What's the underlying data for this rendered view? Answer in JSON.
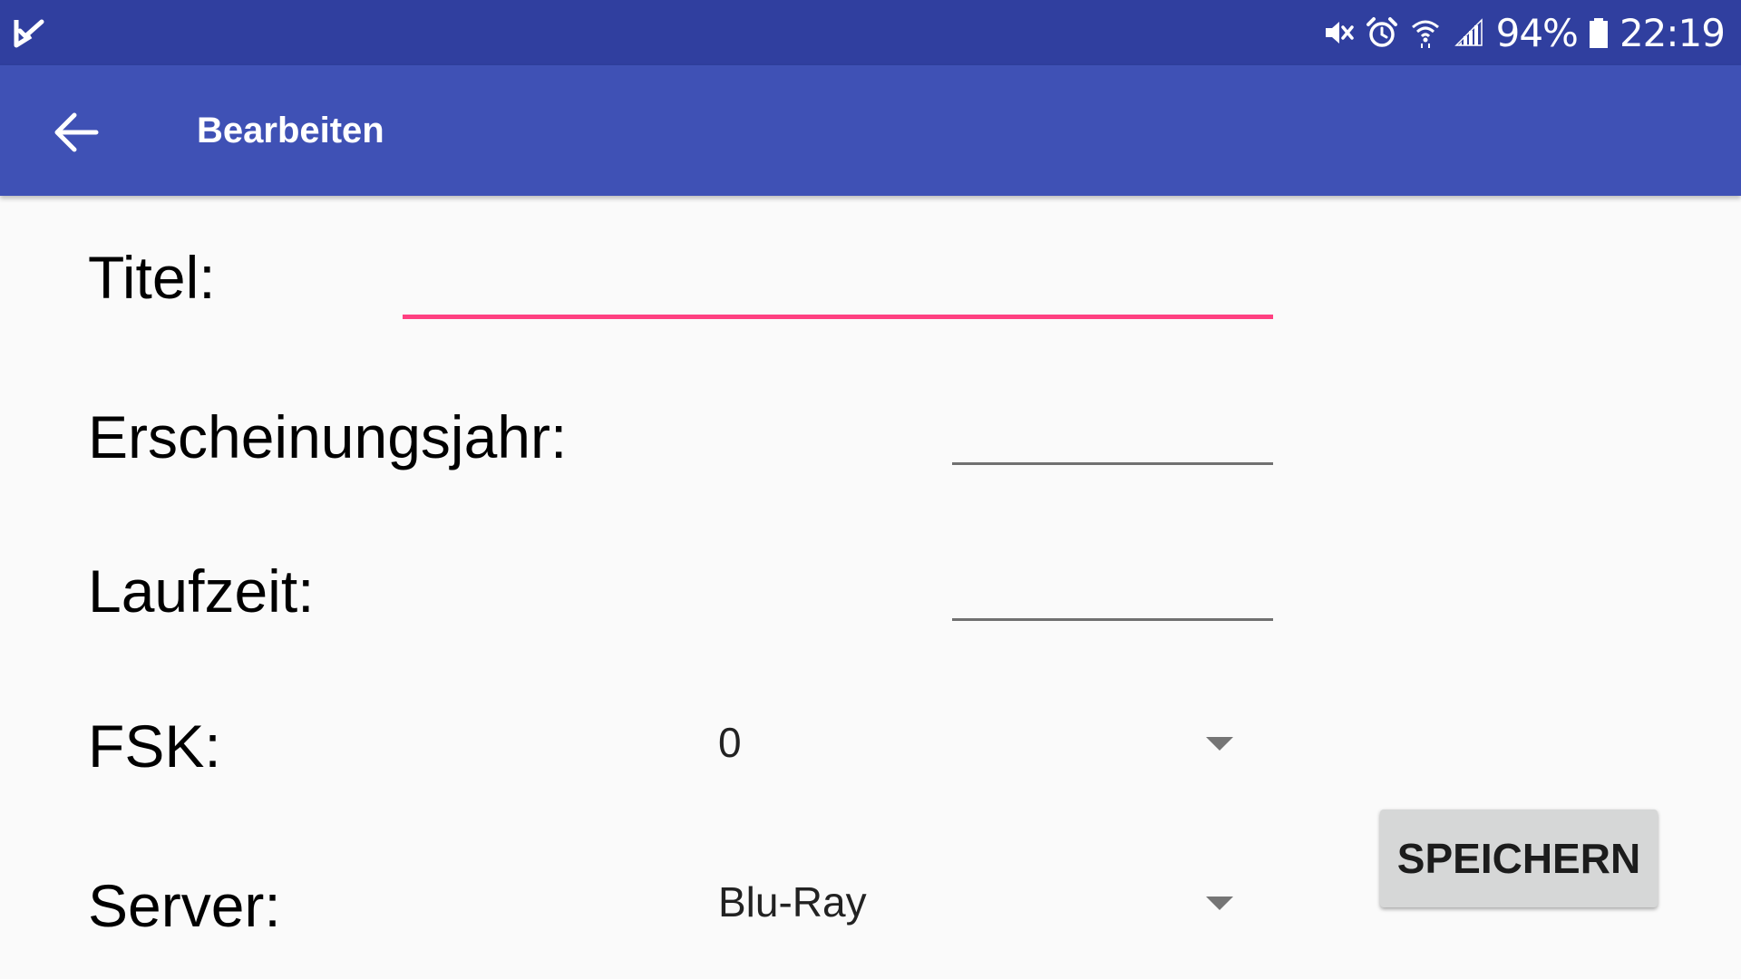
{
  "status_bar": {
    "battery": "94%",
    "time": "22:19",
    "icons": [
      "checkmark-notification-icon",
      "mute-icon",
      "alarm-icon",
      "wifi-icon",
      "signal-icon",
      "battery-icon"
    ]
  },
  "app_bar": {
    "title": "Bearbeiten",
    "back_icon": "arrow-back-icon"
  },
  "form": {
    "title": {
      "label": "Titel:",
      "value": ""
    },
    "year": {
      "label": "Erscheinungsjahr:",
      "value": ""
    },
    "runtime": {
      "label": "Laufzeit:",
      "value": ""
    },
    "fsk": {
      "label": "FSK:",
      "selected": "0"
    },
    "server": {
      "label": "Server:",
      "selected": "Blu-Ray"
    }
  },
  "actions": {
    "save_label": "SPEICHERN"
  },
  "colors": {
    "status_bar": "#303f9f",
    "app_bar": "#3f51b5",
    "accent": "#ff4081",
    "background": "#fafafa",
    "button": "#d6d7d7"
  }
}
